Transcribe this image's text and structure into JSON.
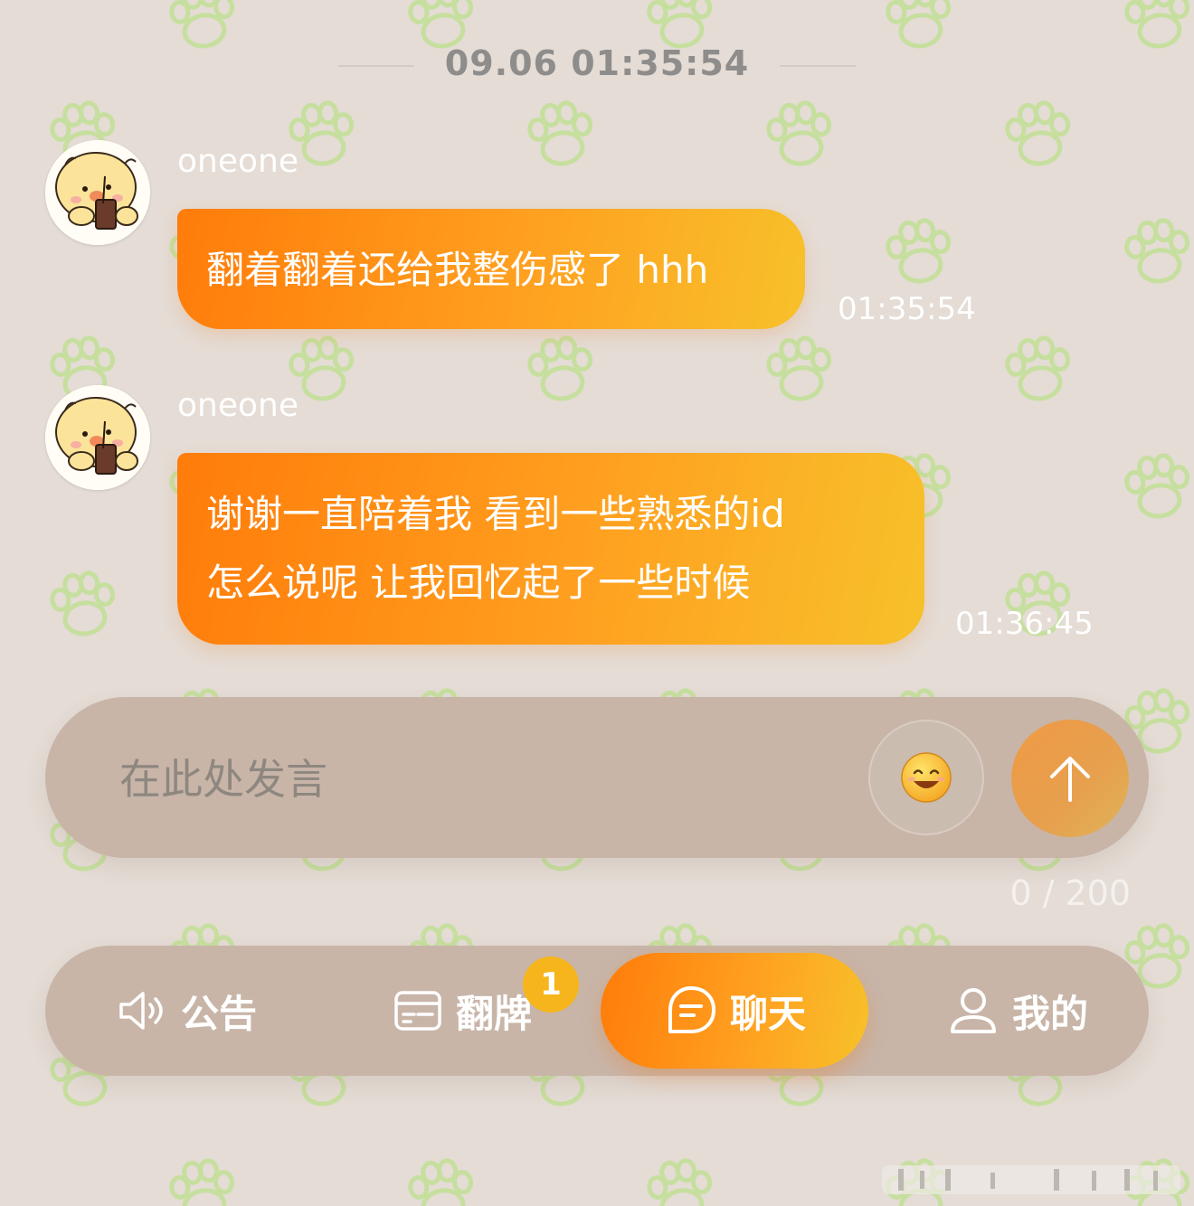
{
  "colors": {
    "background": "#e4dcd5",
    "bubble_gradient_start": "#ff7c0a",
    "bubble_gradient_end": "#f7c12a",
    "bar_background": "#c8b5a8",
    "paw_pattern": "#c6df9e",
    "badge": "#f6b51c"
  },
  "chat": {
    "date_divider": "09.06 01:35:54",
    "messages": [
      {
        "username": "oneone",
        "avatar_icon": "yellow-chick-drinking-avatar",
        "lines": [
          "翻着翻着还给我整伤感了 hhh"
        ],
        "time": "01:35:54"
      },
      {
        "username": "oneone",
        "avatar_icon": "yellow-chick-drinking-avatar",
        "lines": [
          "谢谢一直陪着我 看到一些熟悉的id",
          "怎么说呢 让我回忆起了一些时候"
        ],
        "time": "01:36:45"
      }
    ]
  },
  "composer": {
    "placeholder": "在此处发言",
    "value": "",
    "emoji_icon": "smile-emoji-icon",
    "send_icon": "arrow-up-icon",
    "counter": "0 / 200"
  },
  "tabbar": {
    "items": [
      {
        "label": "公告",
        "icon": "speaker-icon",
        "active": false
      },
      {
        "label": "翻牌",
        "icon": "card-icon",
        "active": false,
        "badge": "1"
      },
      {
        "label": "聊天",
        "icon": "chat-bubble-icon",
        "active": true
      },
      {
        "label": "我的",
        "icon": "user-icon",
        "active": false
      }
    ]
  }
}
